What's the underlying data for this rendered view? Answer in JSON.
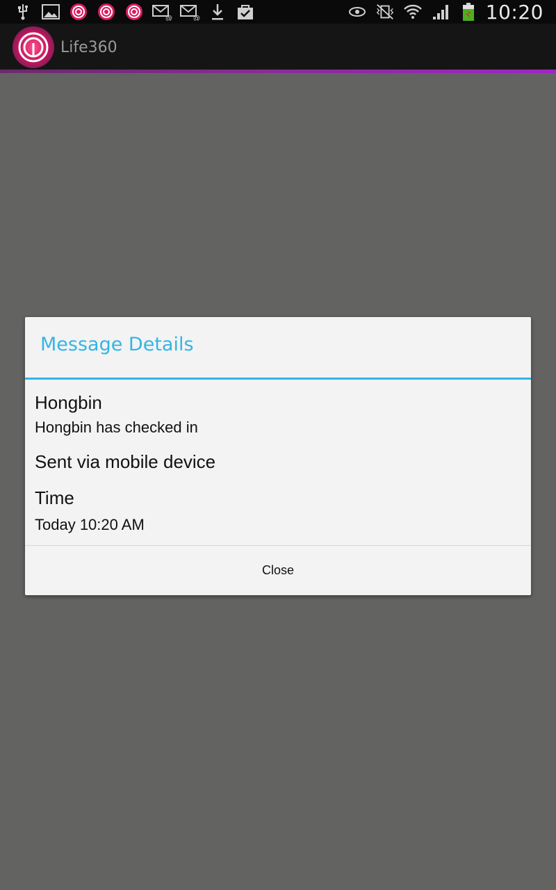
{
  "status_bar": {
    "left_icons": [
      "usb-icon",
      "image-icon",
      "life360-notification-icon",
      "life360-notification-icon",
      "life360-notification-icon",
      "email-icon",
      "email-icon",
      "download-icon",
      "shopping-bag-icon"
    ],
    "right_icons": [
      "eye-icon",
      "vibrate-icon",
      "wifi-icon",
      "signal-icon",
      "battery-charging-icon"
    ],
    "time": "10:20"
  },
  "action_bar": {
    "app_icon": "life360-logo-icon",
    "title": "Life360"
  },
  "dialog": {
    "title": "Message Details",
    "sender": "Hongbin",
    "message": "Hongbin has checked in",
    "source": "Sent via mobile device",
    "time_label": "Time",
    "time_value": "Today 10:20 AM",
    "close_label": "Close"
  },
  "colors": {
    "accent": "#33b5e5",
    "dim_background": "#636362",
    "dialog_background": "#f3f3f3",
    "action_bar_accent": "#8a2a9a"
  }
}
